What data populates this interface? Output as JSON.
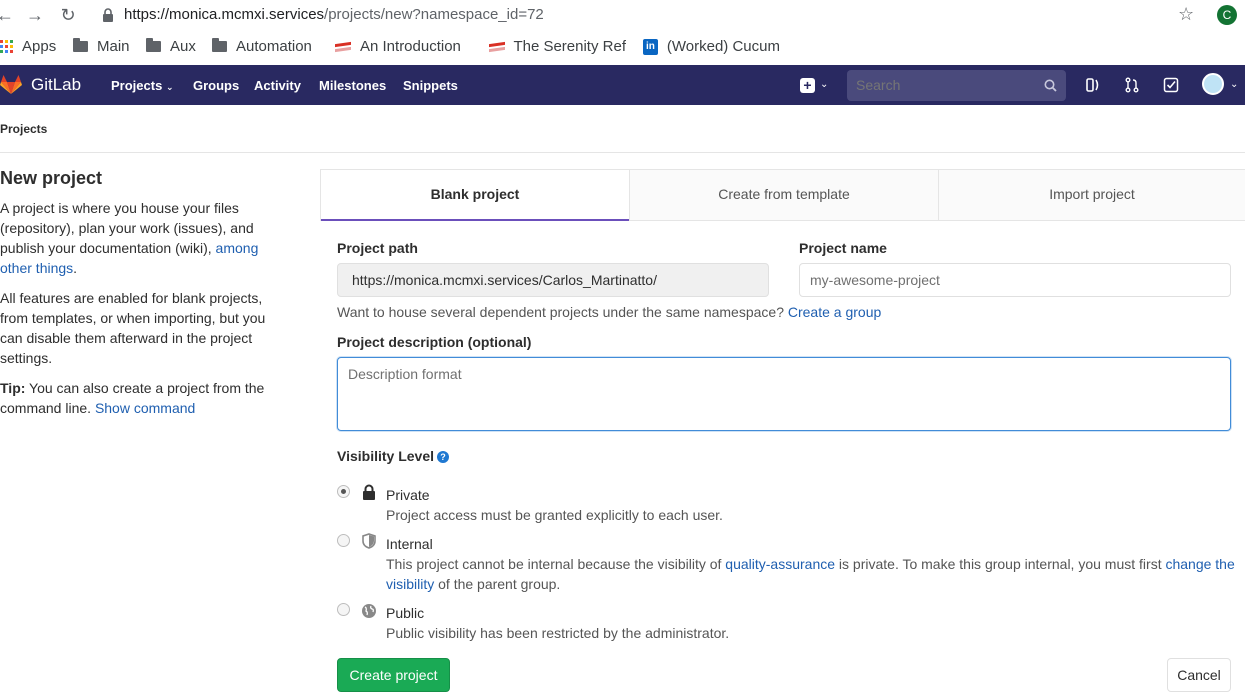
{
  "browser": {
    "url_host": "https://monica.mcmxi.services",
    "url_path": "/projects/new?namespace_id=72",
    "profile_initial": "C",
    "bookmarks": [
      "Apps",
      "Main",
      "Aux",
      "Automation",
      "An Introduction",
      "The Serenity Ref",
      "(Worked) Cucum"
    ]
  },
  "header": {
    "brand": "GitLab",
    "nav": [
      "Projects",
      "Groups",
      "Activity",
      "Milestones",
      "Snippets"
    ],
    "search_placeholder": "Search",
    "color": "#292961"
  },
  "breadcrumb": "Projects",
  "sidebar": {
    "title": "New project",
    "para1_text": "A project is where you house your files (repository), plan your work (issues), and publish your documentation (wiki), ",
    "para1_link": "among other things",
    "para1_end": ".",
    "para2": "All features are enabled for blank projects, from templates, or when importing, but you can disable them afterward in the project settings.",
    "tip_label": "Tip:",
    "tip_text": " You can also create a project from the command line. ",
    "tip_link": "Show command"
  },
  "tabs": [
    "Blank project",
    "Create from template",
    "Import project"
  ],
  "form": {
    "path_label": "Project path",
    "path_value": "https://monica.mcmxi.services/Carlos_Martinatto/",
    "name_label": "Project name",
    "name_placeholder": "my-awesome-project",
    "namespace_help": "Want to house several dependent projects under the same namespace? ",
    "namespace_link": "Create a group",
    "desc_label": "Project description (optional)",
    "desc_placeholder": "Description format",
    "visibility_label": "Visibility Level",
    "visibility": [
      {
        "title": "Private",
        "desc": "Project access must be granted explicitly to each user.",
        "checked": true,
        "icon": "lock-icon"
      },
      {
        "title": "Internal",
        "desc_pre": "This project cannot be internal because the visibility of ",
        "desc_link1": "quality-assurance",
        "desc_mid": " is private. To make this group internal, you must first ",
        "desc_link2": "change the visibility",
        "desc_post": " of the parent group.",
        "checked": false,
        "icon": "shield-icon"
      },
      {
        "title": "Public",
        "desc": "Public visibility has been restricted by the administrator.",
        "checked": false,
        "icon": "globe-icon"
      }
    ],
    "create_label": "Create project",
    "cancel_label": "Cancel"
  }
}
